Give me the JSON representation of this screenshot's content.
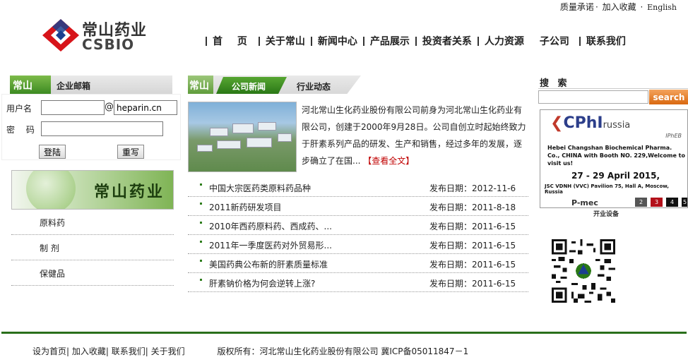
{
  "toplinks": {
    "quality": "质量承诺",
    "favorite": "加入收藏",
    "english": "English"
  },
  "logo": {
    "cn": "常山药业",
    "en": "CSBIO",
    "colors": {
      "red": "#d7141a",
      "blue": "#1b3f8f"
    }
  },
  "nav": [
    "首 页",
    "关于常山",
    "新闻中心",
    "产品展示",
    "投资者关系",
    "人力资源",
    "子公司",
    "联系我们"
  ],
  "mail": {
    "tab_brand": "常山",
    "tab_label": "企业邮箱",
    "user_label": "用户名",
    "at": "@",
    "domain_value": "heparin.cn",
    "password_label": "密  码",
    "login_button": "登陆",
    "reset_button": "重写"
  },
  "banner": {
    "text": "常山药业"
  },
  "categories": [
    "原料药",
    "制 剂",
    "保健品"
  ],
  "news_tabs": {
    "brand": "常山",
    "company_news": "公司新闻",
    "industry_news": "行业动态"
  },
  "intro": {
    "text": "河北常山生化药业股份有限公司前身为河北常山生化药业有限公司，创建于2000年9月28日。公司自创立时起始终致力于肝素系列产品的研发、生产和销售，经过多年的发展，逐步确立了在国...",
    "more": "【查看全文】"
  },
  "news": [
    {
      "title": "中国大宗医药类原料药品种",
      "date": "发布日期：2012-11-6"
    },
    {
      "title": "2011新药研发项目",
      "date": "发布日期：2011-8-18"
    },
    {
      "title": "2010年西药原料药、西成药、...",
      "date": "发布日期：2011-6-15"
    },
    {
      "title": "2011年一季度医药对外贸易形...",
      "date": "发布日期：2011-6-15"
    },
    {
      "title": "美国药典公布新的肝素质量标准",
      "date": "发布日期：2011-6-15"
    },
    {
      "title": "肝素钠价格为何会逆转上涨?",
      "date": "发布日期：2011-6-15"
    }
  ],
  "search": {
    "heading": "搜 索",
    "button": "search",
    "placeholder": ""
  },
  "ad": {
    "logo_main": "CPhI",
    "logo_country": "russia",
    "logo_sub": "IPhEB",
    "description": "Hebei Changshan Biochemical Pharma. Co., CHINA with Booth NO. 229,Welcome to visit us!",
    "dates": "27 - 29 April 2015,",
    "venue": "JSC VDNH (VVC) Pavilion 75, Hall A, Moscow, Russia",
    "pager_brand": "P-mec",
    "pages": [
      "2",
      "3",
      "4",
      "5"
    ],
    "active_page": "3",
    "caption": "开业设备"
  },
  "footer": {
    "set_home": "设为首页",
    "add_favorite": "加入收藏",
    "contact": "联系我们",
    "about": "关于我们",
    "copyright": "版权所有：河北常山生化药业股份有限公司 冀ICP备05011847－1"
  },
  "colors": {
    "green": "#2a7816",
    "footer_line": "#2a6f1b",
    "search_orange": "#e57a1e",
    "more_red": "#c00000"
  }
}
